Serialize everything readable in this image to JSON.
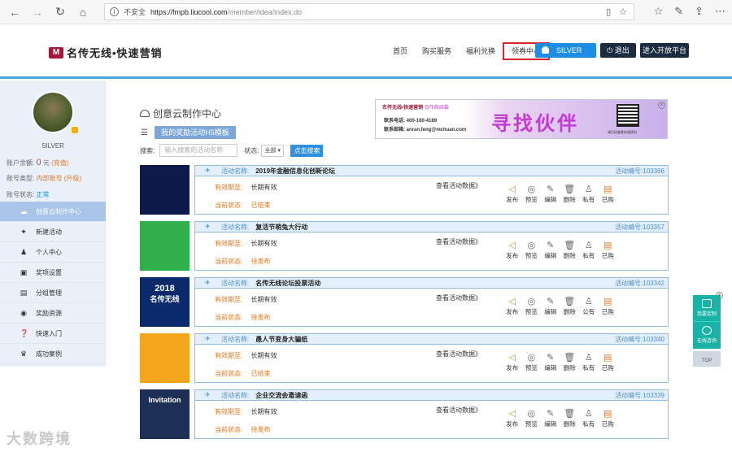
{
  "browser": {
    "insecure": "不安全",
    "url_host": "https://fmpb.liucool.com",
    "url_path": "/member/idea/index.do"
  },
  "header": {
    "logo": "名传无线•快速营销",
    "nav": [
      "首页",
      "购买服务",
      "福利兑换",
      "领券中心"
    ],
    "active_nav": "领券中心",
    "user_label": "SILVER",
    "logout": "退出",
    "open_platform": "进入开放平台"
  },
  "sidebar": {
    "username": "SILVER",
    "balance_label": "账户余额:",
    "balance_value": "0",
    "balance_unit": "元",
    "recharge": "(充值)",
    "account_type_label": "账号类型:",
    "account_type_value": "内部账号",
    "upgrade": "(升级)",
    "account_status_label": "账号状态:",
    "account_status_value": "正常",
    "menu": [
      {
        "label": "创意云制作中心",
        "icon": "cloud-icon",
        "active": true
      },
      {
        "label": "新建活动",
        "icon": "pin-icon",
        "active": false
      },
      {
        "label": "个人中心",
        "icon": "user-icon",
        "active": false
      },
      {
        "label": "奖项设置",
        "icon": "box-icon",
        "active": false
      },
      {
        "label": "分组管理",
        "icon": "group-icon",
        "active": false
      },
      {
        "label": "奖励资源",
        "icon": "coins-icon",
        "active": false
      },
      {
        "label": "快速入门",
        "icon": "help-icon",
        "active": false
      },
      {
        "label": "成功案例",
        "icon": "trophy-icon",
        "active": false
      }
    ]
  },
  "main": {
    "title": "创意云制作中心",
    "template_tab": "我的奖励活动H5模板",
    "search_label": "搜索:",
    "search_placeholder": "输入搜索的活动名称",
    "status_label": "状态:",
    "status_value": "全部",
    "search_button": "点击搜索"
  },
  "ad": {
    "logo": "名传无线•快速营销",
    "tag": "合作商招募",
    "phone_label": "联系电话:",
    "phone": "400-100-4189",
    "email_label": "联系邮箱:",
    "email": "anran.feng@mchuan.com",
    "headline": "寻找伙伴",
    "qr_caption": "请扫码查看申请资料"
  },
  "labels": {
    "name": "活动名称:",
    "period": "有效期至:",
    "status": "当前状态:",
    "view_data": "查看活动数据》",
    "no_prefix": "活动编号:"
  },
  "activities": [
    {
      "name": "2019年金融信息化创新论坛",
      "no": "103366",
      "period": "长期有效",
      "status": "已结束",
      "thumb_top": "",
      "thumb_text": "",
      "thumb_color": "#0e1a4a",
      "ops": [
        "发布",
        "预览",
        "编辑",
        "删除",
        "私有",
        "已购"
      ]
    },
    {
      "name": "复活节萌兔大行动",
      "no": "103357",
      "period": "长期有效",
      "status": "待发布",
      "thumb_top": "",
      "thumb_text": "",
      "thumb_color": "#2fb04b",
      "ops": [
        "发布",
        "预览",
        "编辑",
        "删除",
        "私有",
        "已购"
      ]
    },
    {
      "name": "名传无线论坛投票活动",
      "no": "103342",
      "period": "长期有效",
      "status": "待发布",
      "thumb_top": "2018",
      "thumb_text": "名传无线",
      "thumb_color": "#0a2a6b",
      "ops": [
        "发布",
        "预览",
        "编辑",
        "删除",
        "公有",
        "已购"
      ]
    },
    {
      "name": "愚人节变身大骗纸",
      "no": "103340",
      "period": "长期有效",
      "status": "已结束",
      "thumb_top": "",
      "thumb_text": "",
      "thumb_color": "#f3a61b",
      "ops": [
        "发布",
        "预览",
        "编辑",
        "删除",
        "私有",
        "已购"
      ]
    },
    {
      "name": "企业交流会邀请函",
      "no": "103339",
      "period": "长期有效",
      "status": "待发布",
      "thumb_top": "",
      "thumb_text": "Invitation",
      "thumb_color": "#1d2f55",
      "ops": [
        "发布",
        "预览",
        "编辑",
        "删除",
        "私有",
        "已购"
      ]
    }
  ],
  "float": {
    "service": "我要定制",
    "online": "在线咨询",
    "top": "TOP"
  },
  "watermark": "大数跨境"
}
